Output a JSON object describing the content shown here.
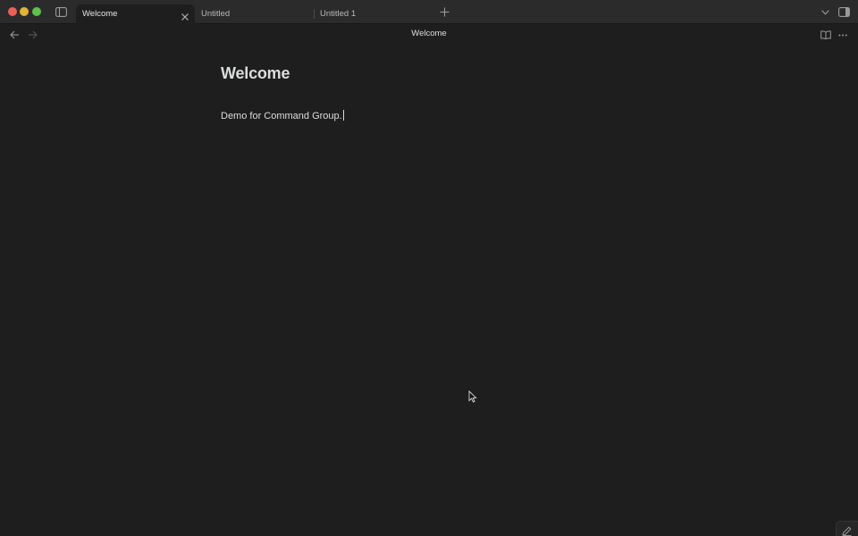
{
  "tabs": [
    {
      "label": "Welcome",
      "active": true
    },
    {
      "label": "Untitled",
      "active": false
    },
    {
      "label": "Untitled 1",
      "active": false
    }
  ],
  "header": {
    "view_title": "Welcome"
  },
  "note": {
    "title": "Welcome",
    "body": "Demo for Command Group."
  },
  "icons": {
    "sidebar_toggle": "sidebar-left-icon",
    "tab_close": "close-icon",
    "new_tab": "plus-icon",
    "tab_list": "chevron-down-icon",
    "right_sidebar_toggle": "sidebar-right-icon",
    "back": "arrow-left-icon",
    "forward": "arrow-right-icon",
    "reading_view": "book-open-icon",
    "more_options": "more-horizontal-icon",
    "edit_mode": "pencil-icon"
  },
  "colors": {
    "background": "#1e1e1e",
    "tabbar": "#2b2b2b",
    "text": "#dcddde",
    "close_red": "#ec5f5a",
    "minimize_yellow": "#e0b43b",
    "zoom_green": "#5fc04b"
  }
}
